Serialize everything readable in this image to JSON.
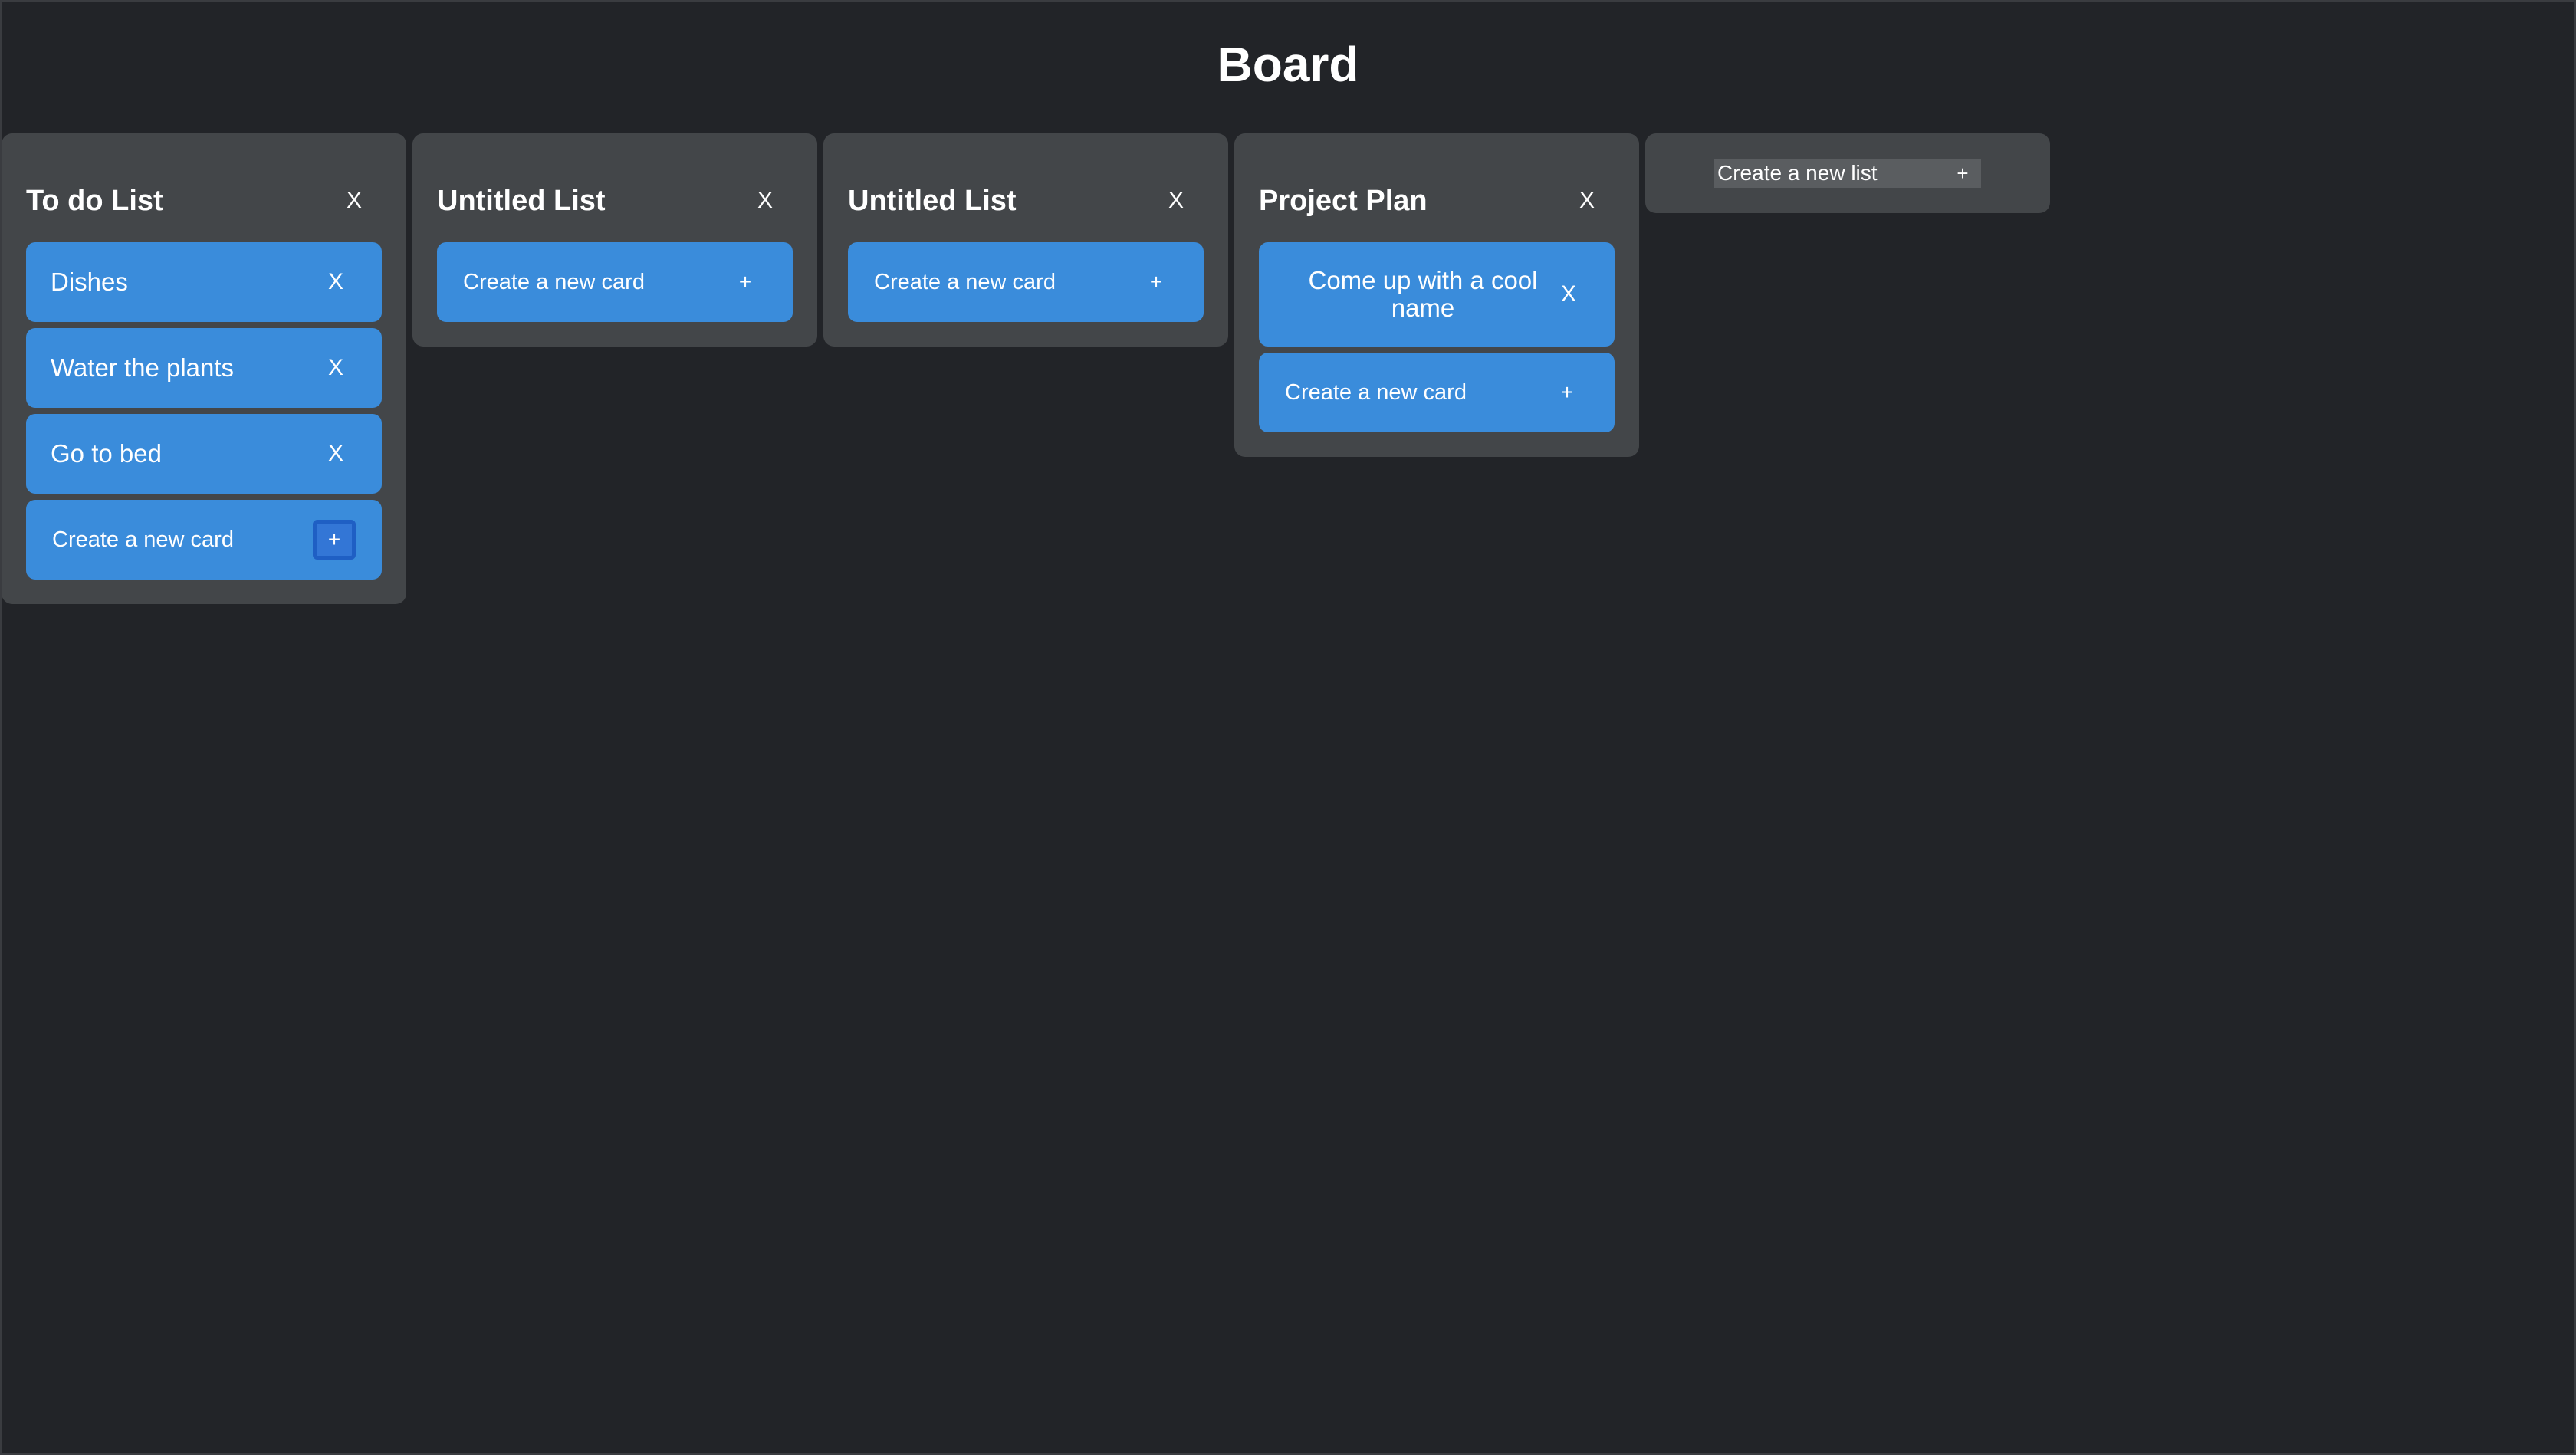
{
  "board": {
    "title": "Board"
  },
  "lists": [
    {
      "title": "To do List",
      "close_label": "X",
      "cards": [
        {
          "text": "Dishes",
          "close_label": "X"
        },
        {
          "text": "Water the plants",
          "close_label": "X"
        },
        {
          "text": "Go to bed",
          "close_label": "X"
        }
      ],
      "create_card_label": "Create a new card",
      "add_label": "+"
    },
    {
      "title": "Untitled List",
      "close_label": "X",
      "cards": [],
      "create_card_label": "Create a new card",
      "add_label": "+"
    },
    {
      "title": "Untitled List",
      "close_label": "X",
      "cards": [],
      "create_card_label": "Create a new card",
      "add_label": "+"
    },
    {
      "title": "Project Plan",
      "close_label": "X",
      "cards": [
        {
          "text": "Come up with a cool name",
          "close_label": "X"
        }
      ],
      "create_card_label": "Create a new card",
      "add_label": "+"
    }
  ],
  "new_list": {
    "label": "Create a new list",
    "add_label": "+"
  },
  "colors": {
    "background": "#222428",
    "list_background": "#434649",
    "card": "#3a8cdb",
    "focus_ring": "#1f5fc4"
  }
}
